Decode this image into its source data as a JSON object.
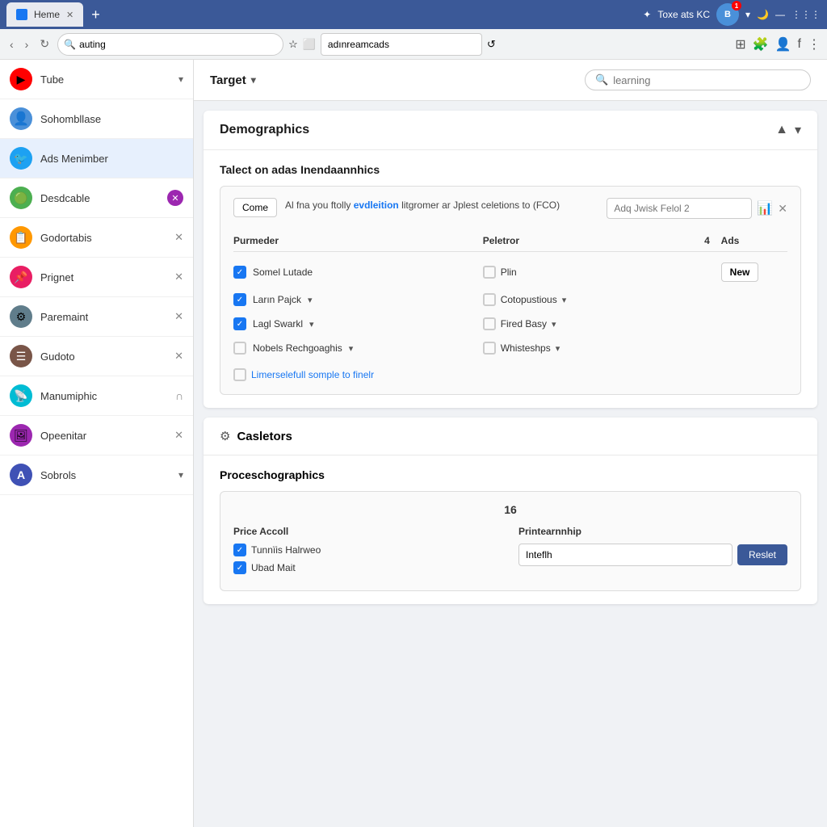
{
  "browser": {
    "tab_title": "Heme",
    "address_bar_value": "auting",
    "url_bar_value": "adınreamcads",
    "profile_label": "Toxe ats KC",
    "notif_count": "1"
  },
  "sidebar": {
    "items": [
      {
        "id": "tube",
        "label": "Tube",
        "icon": "▶",
        "icon_bg": "#ff0000",
        "trailing": "arrow_down",
        "trailing_value": "▾"
      },
      {
        "id": "sohombllase",
        "label": "Sohombllase",
        "icon": "👤",
        "icon_bg": "#4a90d9",
        "trailing": "",
        "trailing_value": ""
      },
      {
        "id": "ads-menimber",
        "label": "Ads Menimber",
        "icon": "🐦",
        "icon_bg": "#1da1f2",
        "trailing": "",
        "trailing_value": "",
        "active": true
      },
      {
        "id": "desdcable",
        "label": "Desdcable",
        "icon": "🟢",
        "icon_bg": "#4caf50",
        "trailing": "badge",
        "trailing_value": "✕"
      },
      {
        "id": "godortabis",
        "label": "Godortabis",
        "icon": "📋",
        "icon_bg": "#ff9800",
        "trailing": "close",
        "trailing_value": "✕"
      },
      {
        "id": "prignet",
        "label": "Prignet",
        "icon": "📌",
        "icon_bg": "#e91e63",
        "trailing": "close",
        "trailing_value": "✕"
      },
      {
        "id": "paremaint",
        "label": "Paremaint",
        "icon": "⚙",
        "icon_bg": "#607d8b",
        "trailing": "close",
        "trailing_value": "✕"
      },
      {
        "id": "gudoto",
        "label": "Gudoto",
        "icon": "☰",
        "icon_bg": "#795548",
        "trailing": "close",
        "trailing_value": "✕"
      },
      {
        "id": "manumiphic",
        "label": "Manumiphic",
        "icon": "📡",
        "icon_bg": "#00bcd4",
        "trailing": "intersect",
        "trailing_value": "∩"
      },
      {
        "id": "opeenitar",
        "label": "Opeenitar",
        "icon": "🖼",
        "icon_bg": "#9c27b0",
        "trailing": "close",
        "trailing_value": "✕"
      },
      {
        "id": "sobrols",
        "label": "Sobrols",
        "icon": "🅐",
        "icon_bg": "#3f51b5",
        "trailing": "arrow_down",
        "trailing_value": "▾"
      }
    ]
  },
  "header": {
    "target_label": "Target",
    "search_placeholder": "learning"
  },
  "demographics": {
    "section_title": "Demographics",
    "sub_title": "Talect on adas Inendaannhics",
    "info_text": "Al fna you ftolly evdleition litgromer ar Jplest celetions to (FCO)",
    "come_btn": "Come",
    "link_text": "evdleition",
    "input_placeholder": "Adq Jwisk Felol 2",
    "column_headers": {
      "parameter": "Purmeder",
      "selector": "Peletror",
      "num": "4",
      "ads": "Ads"
    },
    "rows": [
      {
        "param_checked": true,
        "param_label": "Somel Lutade",
        "param_has_dropdown": false,
        "sel_checked": false,
        "sel_label": "Plin",
        "sel_has_dropdown": false,
        "show_new": true
      },
      {
        "param_checked": true,
        "param_label": "Ların Pajck",
        "param_has_dropdown": true,
        "sel_checked": false,
        "sel_label": "Cotopustious",
        "sel_has_dropdown": true,
        "show_new": false
      },
      {
        "param_checked": true,
        "param_label": "Lagl Swarkl",
        "param_has_dropdown": true,
        "sel_checked": false,
        "sel_label": "Fired Basy",
        "sel_has_dropdown": true,
        "show_new": false
      },
      {
        "param_checked": false,
        "param_label": "Nobels Rechgoaghis",
        "param_has_dropdown": true,
        "sel_checked": false,
        "sel_label": "Whisteshps",
        "sel_has_dropdown": true,
        "show_new": false
      }
    ],
    "link_bottom_text": "Limerselefull somple to finelr",
    "link_bottom_checked": false
  },
  "casletors": {
    "section_title": "Casletors",
    "sub_title": "Proceschographics",
    "center_num": "16",
    "col1_header": "Price Accoll",
    "col2_header": "Printearnnhip",
    "col1_items": [
      {
        "checked": true,
        "label": "Tunnïis Halrweo"
      },
      {
        "checked": true,
        "label": "Ubad Mait"
      }
    ],
    "col2_input": "Inteflh",
    "col2_btn": "Reslet"
  }
}
